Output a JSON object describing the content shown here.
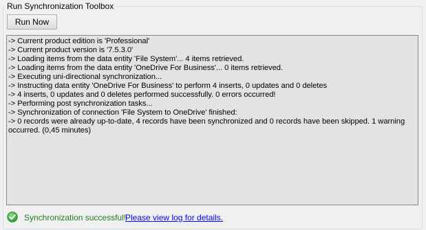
{
  "toolbox": {
    "title": "Run Synchronization Toolbox",
    "run_button_label": "Run Now"
  },
  "log": {
    "lines": [
      "-> Current product edition is 'Professional'",
      "-> Current product version is '7.5.3.0'",
      "-> Loading items from the data entity 'File System'... 4 items retrieved.",
      "-> Loading items from the data entity 'OneDrive For Business'... 0 items retrieved.",
      "-> Executing uni-directional synchronization...",
      "-> Instructing data entity 'OneDrive For Business' to perform 4 inserts, 0 updates and 0 deletes",
      "-> 4 inserts, 0 updates and 0 deletes performed successfully. 0 errors occurred!",
      "-> Performing post synchronization tasks...",
      "-> Synchronization of connection 'File System to OneDrive' finished:",
      "-> 0 records were already up-to-date, 4 records have been synchronized and 0 records have been skipped. 1 warning occurred. (0,45 minutes)"
    ]
  },
  "status": {
    "icon": "check-circle-icon",
    "icon_color": "#3aa13a",
    "message": "Synchronization successful!",
    "message_color": "#1e7a1e",
    "link_text": "Please view log for details."
  }
}
